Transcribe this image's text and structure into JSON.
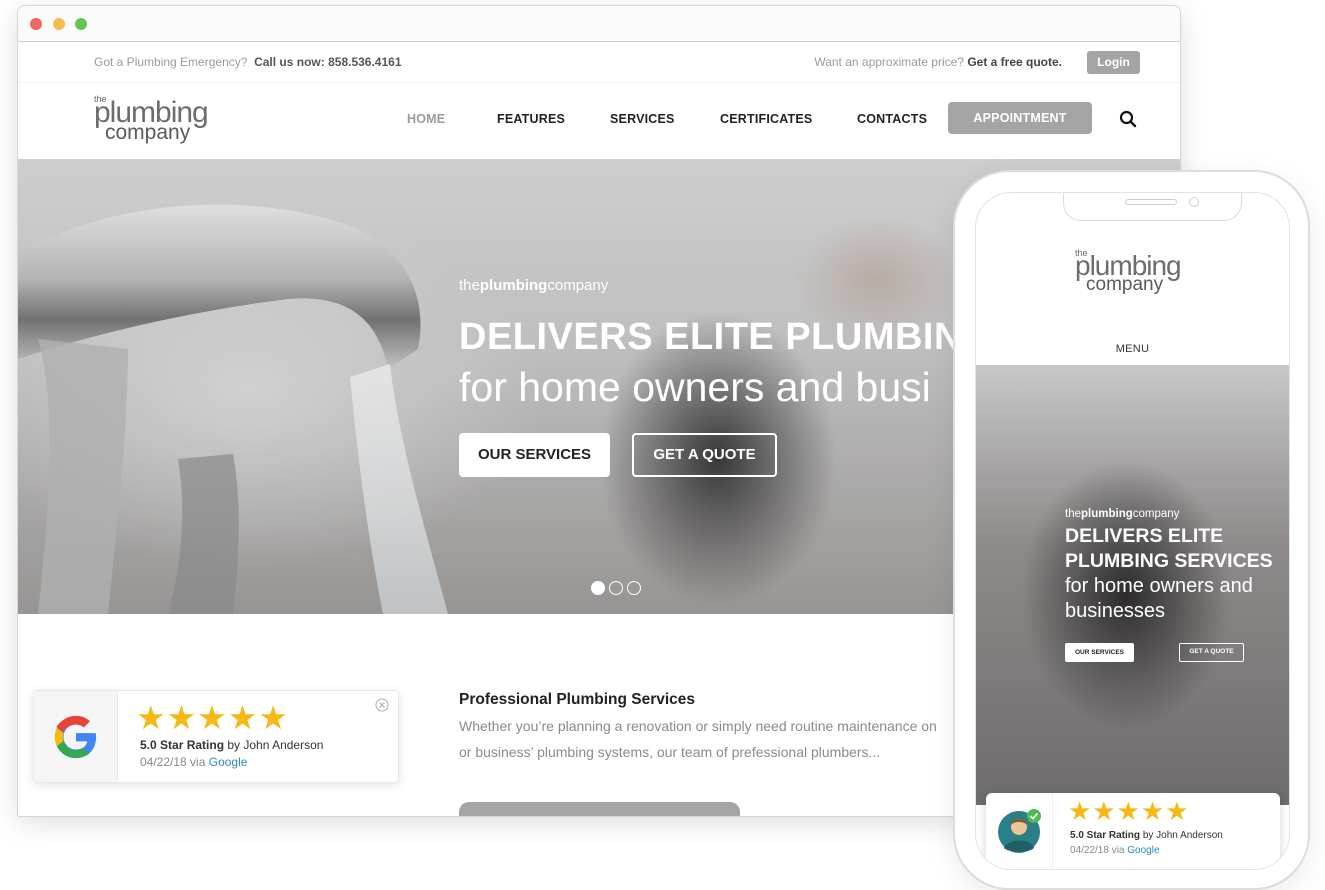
{
  "browser": {
    "topbar": {
      "emergency_text": "Got a Plumbing Emergency?",
      "call_text": "Call us now: 858.536.4161",
      "price_text": "Want an approximate price?",
      "quote_text": "Get a free quote.",
      "login_label": "Login"
    },
    "logo": {
      "the": "the",
      "word1": "plumbing",
      "word2": "company"
    },
    "nav": {
      "items": [
        {
          "label": "HOME",
          "active": true
        },
        {
          "label": "FEATURES"
        },
        {
          "label": "SERVICES"
        },
        {
          "label": "CERTIFICATES"
        },
        {
          "label": "CONTACTS"
        }
      ],
      "appointment_label": "APPOINTMENT",
      "search_icon": "search-icon"
    },
    "hero": {
      "brand_prefix": "the",
      "brand_bold": "plumbing",
      "brand_suffix": "company",
      "title": "DELIVERS ELITE PLUMBING",
      "subtitle": "for home owners and busi",
      "services_button": "OUR SERVICES",
      "quote_button": "GET A QUOTE",
      "slides": 3,
      "active_slide": 1
    },
    "review": {
      "stars": "★★★★★",
      "rating_bold": "5.0 Star Rating",
      "rating_by": "by John Anderson",
      "date": "04/22/18 via",
      "source": "Google"
    },
    "content": {
      "title": "Professional Plumbing Services",
      "line1": "Whether you’re planning a renovation or simply need routine maintenance on",
      "line2": "or business’ plumbing systems, our team of prefessional plumbers..."
    }
  },
  "phone": {
    "logo": {
      "the": "the",
      "word1": "plumbing",
      "word2": "company"
    },
    "menu_label": "MENU",
    "hero": {
      "brand_prefix": "the",
      "brand_bold": "plumbing",
      "brand_suffix": "company",
      "title_line1": "DELIVERS ELITE",
      "title_line2": "PLUMBING SERVICES",
      "sub_line1": "for home owners and",
      "sub_line2": "businesses",
      "services_button": "OUR SERVICES",
      "quote_button": "GET A QUOTE"
    },
    "review": {
      "stars": "★★★★★",
      "rating_bold": "5.0 Star Rating",
      "rating_by": "by John Anderson",
      "date": "04/22/18 via",
      "source": "Google"
    }
  },
  "colors": {
    "accent_gray": "#a4a4a4",
    "star": "#f5b814",
    "google_link": "#2a8ac0",
    "check_green": "#4cbb56"
  }
}
